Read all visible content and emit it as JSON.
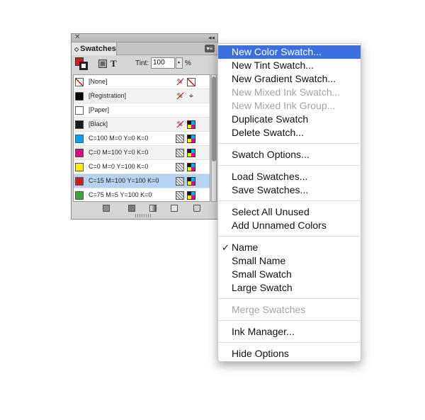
{
  "panel": {
    "tab_label": "Swatches",
    "tint_label": "Tint:",
    "tint_value": "100",
    "tint_unit": "%",
    "swatches": [
      {
        "label": "[None]",
        "color": "#ffffff"
      },
      {
        "label": "[Registration]",
        "color": "#000000"
      },
      {
        "label": "[Paper]",
        "color": "#ffffff"
      },
      {
        "label": "[Black]",
        "color": "#1a1a1a"
      },
      {
        "label": "C=100 M=0 Y=0 K=0",
        "color": "#00a6e8"
      },
      {
        "label": "C=0 M=100 Y=0 K=0",
        "color": "#e4007f"
      },
      {
        "label": "C=0 M=0 Y=100 K=0",
        "color": "#ffef00"
      },
      {
        "label": "C=15 M=100 Y=100 K=0",
        "color": "#d01a1e"
      },
      {
        "label": "C=75 M=5 Y=100 K=0",
        "color": "#3ca53a"
      }
    ]
  },
  "menu": {
    "groups": [
      [
        {
          "label": "New Color Swatch...",
          "state": "highlighted"
        },
        {
          "label": "New Tint Swatch...",
          "state": "enabled"
        },
        {
          "label": "New Gradient Swatch...",
          "state": "enabled"
        },
        {
          "label": "New Mixed Ink Swatch...",
          "state": "disabled"
        },
        {
          "label": "New Mixed Ink Group...",
          "state": "disabled"
        },
        {
          "label": "Duplicate Swatch",
          "state": "enabled"
        },
        {
          "label": "Delete Swatch...",
          "state": "enabled"
        }
      ],
      [
        {
          "label": "Swatch Options...",
          "state": "enabled"
        }
      ],
      [
        {
          "label": "Load Swatches...",
          "state": "enabled"
        },
        {
          "label": "Save Swatches...",
          "state": "enabled"
        }
      ],
      [
        {
          "label": "Select All Unused",
          "state": "enabled"
        },
        {
          "label": "Add Unnamed Colors",
          "state": "enabled"
        }
      ],
      [
        {
          "label": "Name",
          "state": "checked"
        },
        {
          "label": "Small Name",
          "state": "enabled"
        },
        {
          "label": "Small Swatch",
          "state": "enabled"
        },
        {
          "label": "Large Swatch",
          "state": "enabled"
        }
      ],
      [
        {
          "label": "Merge Swatches",
          "state": "disabled"
        }
      ],
      [
        {
          "label": "Ink Manager...",
          "state": "enabled"
        }
      ],
      [
        {
          "label": "Hide Options",
          "state": "enabled"
        }
      ]
    ]
  }
}
